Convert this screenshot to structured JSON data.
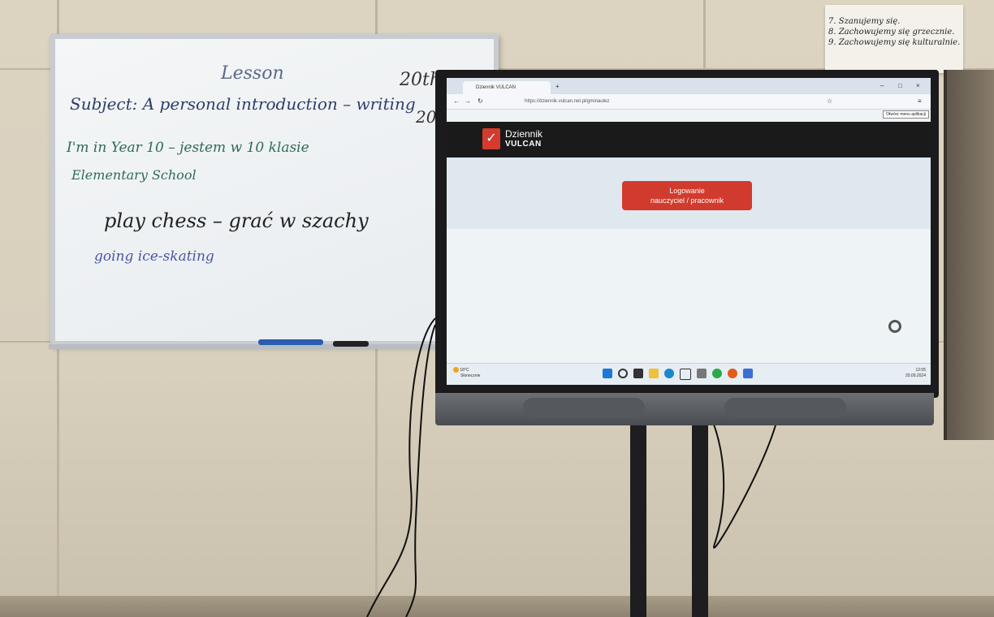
{
  "whiteboard": {
    "title": "Lesson",
    "date_1": "20th S",
    "date_2": "20",
    "subject_line": "Subject: A personal introduction – writing",
    "line_1": "I'm in Year 10 – jestem w 10 klasie",
    "line_2": "Elementary School",
    "line_3": "play chess – grać w szachy",
    "line_4": "going ice-skating"
  },
  "poster": {
    "lines": [
      "7. Szanujemy się.",
      "8. Zachowujemy się grzecznie.",
      "9. Zachowujemy się kulturalnie."
    ]
  },
  "screen": {
    "browser_tab": "Dziennik VULCAN",
    "url": "https://dziennik.vulcan.net.pl/gminaulez",
    "tooltip": "Otwórz menu aplikacji",
    "logo_line_1": "Dziennik",
    "logo_line_2": "VULCAN",
    "login_button_line_1": "Logowanie",
    "login_button_line_2": "nauczyciel / pracownik",
    "weather_temp": "18°C",
    "weather_desc": "Słonecznie",
    "clock_time": "12:05",
    "clock_date": "20.09.2024"
  }
}
